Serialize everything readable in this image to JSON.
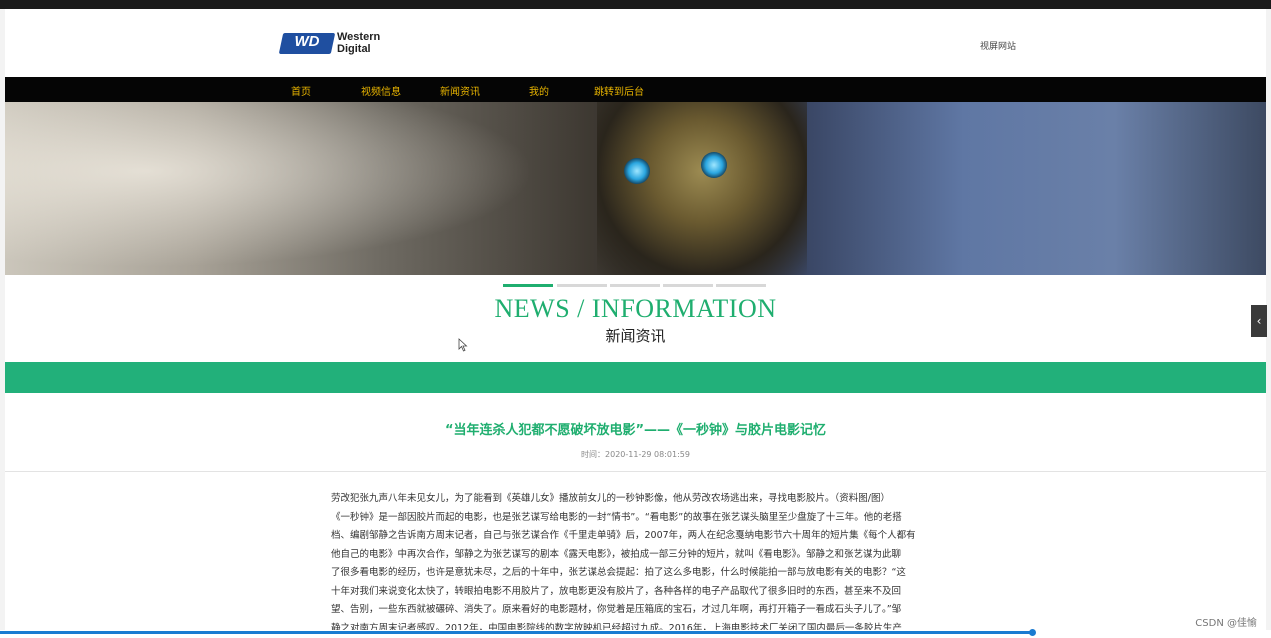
{
  "header": {
    "logo_word_line1": "Western",
    "logo_word_line2": "Digital",
    "logo_mark": "WD",
    "site_link": "视屏网站"
  },
  "nav": {
    "items": [
      "首页",
      "视频信息",
      "新闻资讯",
      "我的",
      "跳转到后台"
    ]
  },
  "banner": {
    "slides_count": 5,
    "active_slide": 1
  },
  "section": {
    "title_en": "NEWS / INFORMATION",
    "title_cn": "新闻资讯"
  },
  "article": {
    "title": "“当年连杀人犯都不愿破坏放电影”——《一秒钟》与胶片电影记忆",
    "time": "时间：2020-11-29 08:01:59",
    "lines": [
      "劳改犯张九声八年未见女儿，为了能看到《英雄儿女》播放前女儿的一秒钟影像，他从劳改农场逃出来，寻找电影胶片。（资料图/图）",
      "《一秒钟》是一部因胶片而起的电影，也是张艺谋写给电影的一封“情书”。“看电影”的故事在张艺谋头脑里至少盘旋了十三年。他的老搭",
      "档、编剧邹静之告诉南方周末记者，自己与张艺谋合作《千里走单骑》后，2007年，两人在纪念戛纳电影节六十周年的短片集《每个人都有",
      "他自己的电影》中再次合作，邹静之为张艺谋写的剧本《露天电影》，被拍成一部三分钟的短片，就叫《看电影》。邹静之和张艺谋为此聊",
      "了很多看电影的经历，也许是意犹未尽，之后的十年中，张艺谋总会提起：拍了这么多电影，什么时候能拍一部与放电影有关的电影？“这",
      "十年对我们来说变化太快了，转眼拍电影不用胶片了，放电影更没有胶片了，各种各样的电子产品取代了很多旧时的东西，甚至来不及回",
      "望、告别，一些东西就被碾碎、消失了。原来看好的电影题材，你觉着是压箱底的宝石，才过几年啊，再打开箱子一看成石头子儿了。”邹",
      "静之对南方周末记者感叹。2012年，中国电影院线的数字放映机已经超过九成。2016年，上海电影技术厂关闭了国内最后一条胶片生产"
    ]
  },
  "side_tab": {
    "icon": "chevron-left-icon",
    "glyph": "‹"
  },
  "watermark": "CSDN @佳愉",
  "colors": {
    "accent_green": "#1fae6f",
    "nav_text": "#e8b400",
    "nav_bg": "#050505",
    "logo_blue": "#1f4fa0"
  }
}
